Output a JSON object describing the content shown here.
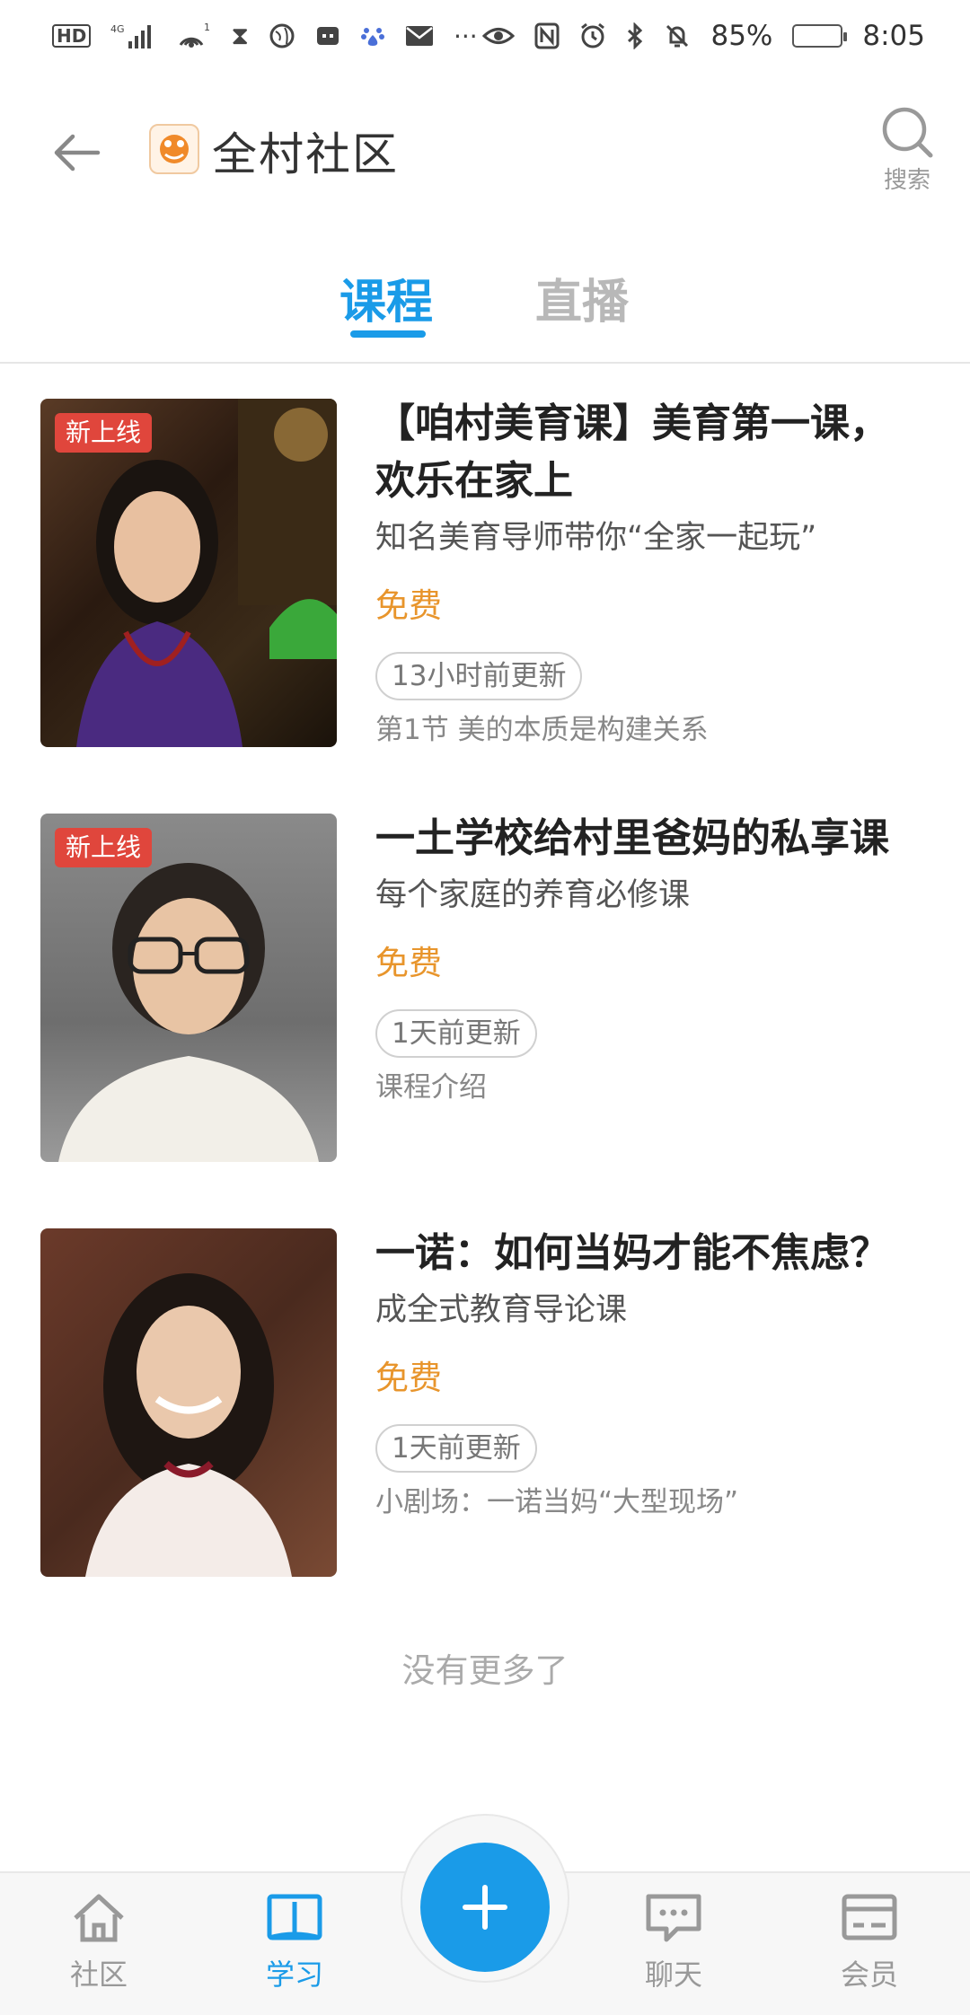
{
  "status_bar": {
    "left_icons": [
      "hd-icon",
      "signal-icon",
      "hotspot-icon",
      "hourglass-icon",
      "globe-icon",
      "app-icon",
      "baidu-icon",
      "mail-icon",
      "more-icon"
    ],
    "hd_label": "HD",
    "network_label": "4G",
    "hotspot_count": "1",
    "more_label": "···",
    "battery_percent_label": "85%",
    "battery_level": 0.85,
    "time": "8:05"
  },
  "header": {
    "title": "全村社区",
    "search_label": "搜索"
  },
  "tabs": [
    {
      "label": "课程",
      "active": true
    },
    {
      "label": "直播",
      "active": false
    }
  ],
  "courses": [
    {
      "badge": "新上线",
      "title": "【咱村美育课】美育第一课，欢乐在家上",
      "subtitle": "知名美育导师带你“全家一起玩”",
      "price": "免费",
      "updated": "13小时前更新",
      "section": "第1节 美的本质是构建关系"
    },
    {
      "badge": "新上线",
      "title": "一土学校给村里爸妈的私享课",
      "subtitle": "每个家庭的养育必修课",
      "price": "免费",
      "updated": "1天前更新",
      "section": "课程介绍"
    },
    {
      "badge": "",
      "title": "一诺：如何当妈才能不焦虑？",
      "subtitle": "成全式教育导论课",
      "price": "免费",
      "updated": "1天前更新",
      "section": "小剧场：一诺当妈“大型现场”"
    }
  ],
  "no_more_text": "没有更多了",
  "bottom_nav": {
    "items": [
      {
        "label": "社区",
        "icon": "home-icon"
      },
      {
        "label": "学习",
        "icon": "book-icon"
      },
      {
        "label": "聊天",
        "icon": "chat-icon"
      },
      {
        "label": "会员",
        "icon": "member-card-icon"
      }
    ],
    "active": "学习",
    "fab_icon": "plus-icon"
  },
  "colors": {
    "accent": "#1a9be8",
    "price": "#e8952c",
    "badge": "#e0463c"
  }
}
